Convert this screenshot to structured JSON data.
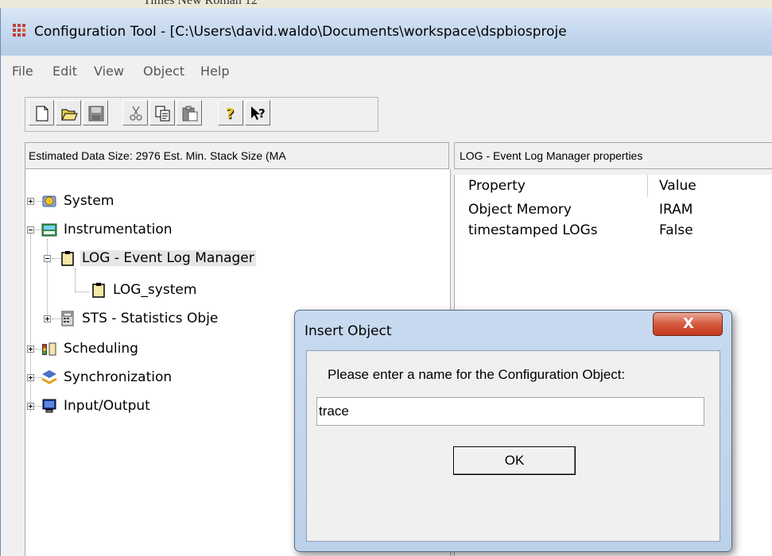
{
  "top_strip": {
    "cut_text": "Times New Roman  12"
  },
  "window": {
    "title": "Configuration Tool - [C:\\Users\\david.waldo\\Documents\\workspace\\dspbiosproje",
    "menu": [
      "File",
      "Edit",
      "View",
      "Object",
      "Help"
    ],
    "toolbar_icons": [
      "new-icon",
      "open-icon",
      "save-icon",
      "cut-icon",
      "copy-icon",
      "paste-icon",
      "help-icon",
      "context-help-icon"
    ]
  },
  "left_panel": {
    "header": "Estimated Data Size: 2976   Est. Min. Stack Size (MA",
    "tree": {
      "system": "System",
      "instrumentation": "Instrumentation",
      "log_manager": "LOG - Event Log Manager",
      "log_system": "LOG_system",
      "sts": "STS - Statistics Obje",
      "scheduling": "Scheduling",
      "synchronization": "Synchronization",
      "io": "Input/Output"
    }
  },
  "right_panel": {
    "header": "LOG - Event Log Manager properties",
    "columns": {
      "property": "Property",
      "value": "Value"
    },
    "rows": [
      {
        "property": "Object Memory",
        "value": "IRAM"
      },
      {
        "property": "timestamped LOGs",
        "value": "False"
      }
    ]
  },
  "dialog": {
    "title": "Insert Object",
    "close": "X",
    "prompt": "Please enter a name for the Configuration Object:",
    "input_value": "trace",
    "ok": "OK"
  }
}
